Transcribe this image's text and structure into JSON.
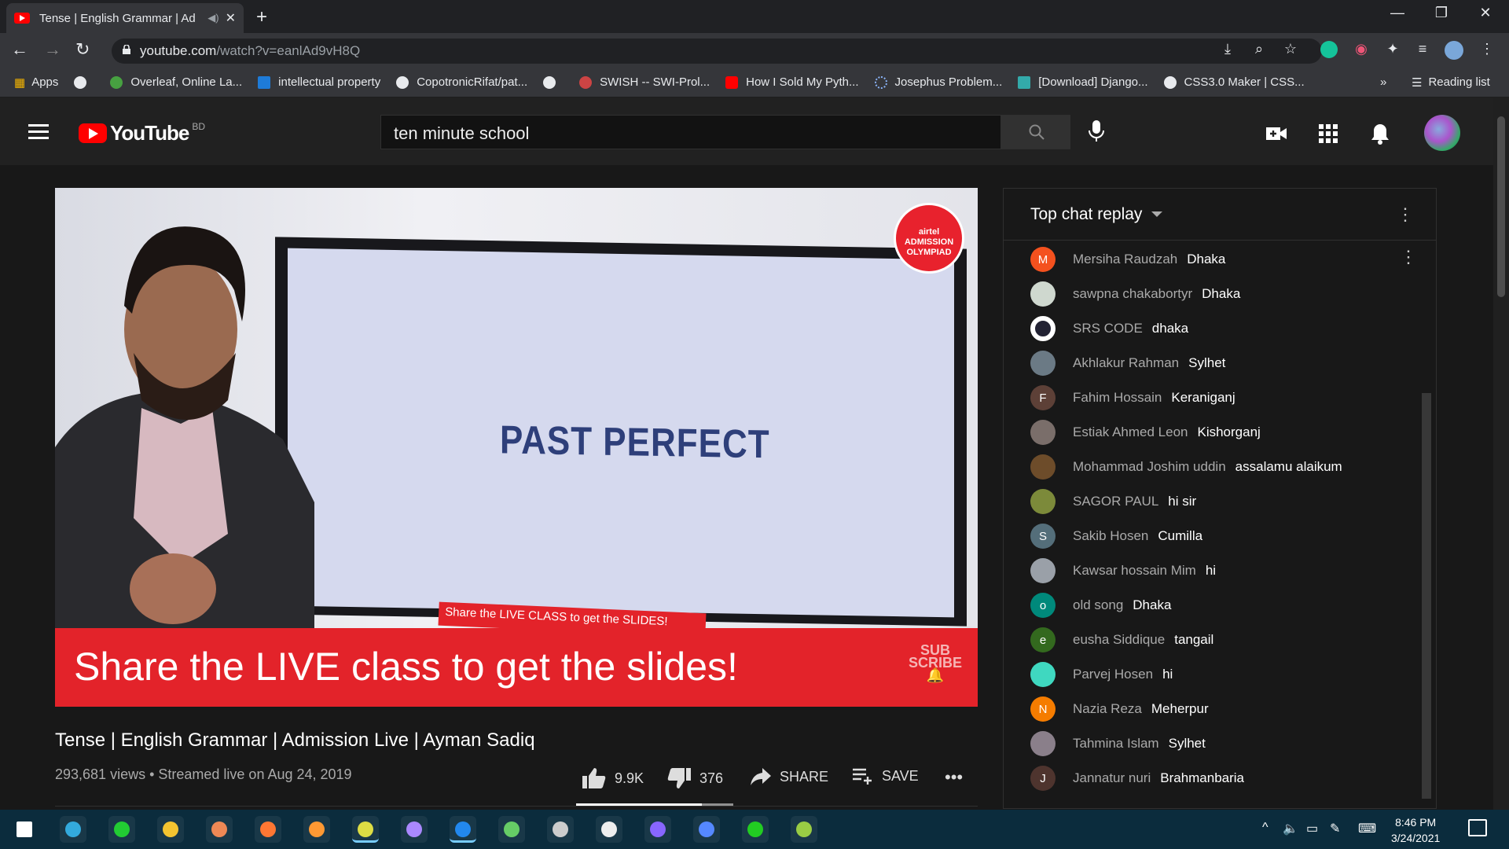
{
  "browser": {
    "tab_title": "Tense | English Grammar | Ad",
    "url_host": "youtube.com",
    "url_path": "/watch?v=eanlAd9vH8Q",
    "bookmarks": [
      "Apps",
      "",
      "Overleaf, Online La...",
      "intellectual property",
      "CopotronicRifat/pat...",
      "",
      "SWISH -- SWI-Prol...",
      "How I Sold My Pyth...",
      "Josephus Problem...",
      "[Download] Django...",
      "CSS3.0 Maker | CSS..."
    ],
    "more": "»",
    "reading_list": "Reading list"
  },
  "youtube": {
    "logo": "YouTube",
    "region": "BD",
    "search_value": "ten minute school"
  },
  "video": {
    "slide_text": "PAST PERFECT",
    "banner": "Share the LIVE class to get the slides!",
    "strip": "Share the LIVE CLASS to get the SLIDES!",
    "badge": [
      "airtel",
      "ADMISSION",
      "OLYMPIAD"
    ],
    "subscribe": [
      "SUB",
      "SCRIBE"
    ],
    "title": "Tense | English Grammar | Admission Live | Ayman Sadiq",
    "meta": "293,681 views • Streamed live on Aug 24, 2019",
    "likes": "9.9K",
    "like_ratio": 0.8,
    "dislikes": "376",
    "share": "SHARE",
    "save": "SAVE"
  },
  "chat": {
    "header": "Top chat replay",
    "messages": [
      {
        "initial": "M",
        "name": "Mersiha Raudzah",
        "text": "Dhaka",
        "color": "#f4511e"
      },
      {
        "initial": "",
        "name": "sawpna chakabortyr",
        "text": "Dhaka",
        "color": "#cfd8cf"
      },
      {
        "initial": "",
        "name": "SRS CODE",
        "text": "dhaka",
        "color": "#ffffff"
      },
      {
        "initial": "",
        "name": "Akhlakur Rahman",
        "text": "Sylhet",
        "color": "#6b7a85"
      },
      {
        "initial": "F",
        "name": "Fahim Hossain",
        "text": "Keraniganj",
        "color": "#5d4037"
      },
      {
        "initial": "",
        "name": "Estiak Ahmed Leon",
        "text": "Kishorganj",
        "color": "#7a6e6a"
      },
      {
        "initial": "",
        "name": "Mohammad Joshim uddin",
        "text": "assalamu alaikum",
        "color": "#6d4c2a"
      },
      {
        "initial": "",
        "name": "SAGOR PAUL",
        "text": "hi sir",
        "color": "#7c8a3a"
      },
      {
        "initial": "S",
        "name": "Sakib Hosen",
        "text": "Cumilla",
        "color": "#546e7a"
      },
      {
        "initial": "",
        "name": "Kawsar hossain Mim",
        "text": "hi",
        "color": "#9aa0a8"
      },
      {
        "initial": "o",
        "name": "old song",
        "text": "Dhaka",
        "color": "#00897b"
      },
      {
        "initial": "e",
        "name": "eusha Siddique",
        "text": "tangail",
        "color": "#33691e"
      },
      {
        "initial": "",
        "name": "Parvej Hosen",
        "text": "hi",
        "color": "#3fd8c0"
      },
      {
        "initial": "N",
        "name": "Nazia Reza",
        "text": "Meherpur",
        "color": "#f57c00"
      },
      {
        "initial": "",
        "name": "Tahmina Islam",
        "text": "Sylhet",
        "color": "#8a7f8a"
      },
      {
        "initial": "J",
        "name": "Jannatur nuri",
        "text": "Brahmanbaria",
        "color": "#4e342e"
      }
    ]
  },
  "taskbar": {
    "time": "8:46 PM",
    "date": "3/24/2021",
    "apps": [
      "windows-icon",
      "edge-icon",
      "whatsapp-icon",
      "file-explorer-icon",
      "brave-icon",
      "firefox-icon",
      "photos-icon",
      "chrome-icon",
      "github-desktop-icon",
      "vscode-icon",
      "earth-icon",
      "webstorm-icon",
      "inkscape-icon",
      "visual-studio-icon",
      "messenger-icon",
      "pycharm-icon",
      "notepad-icon"
    ]
  }
}
